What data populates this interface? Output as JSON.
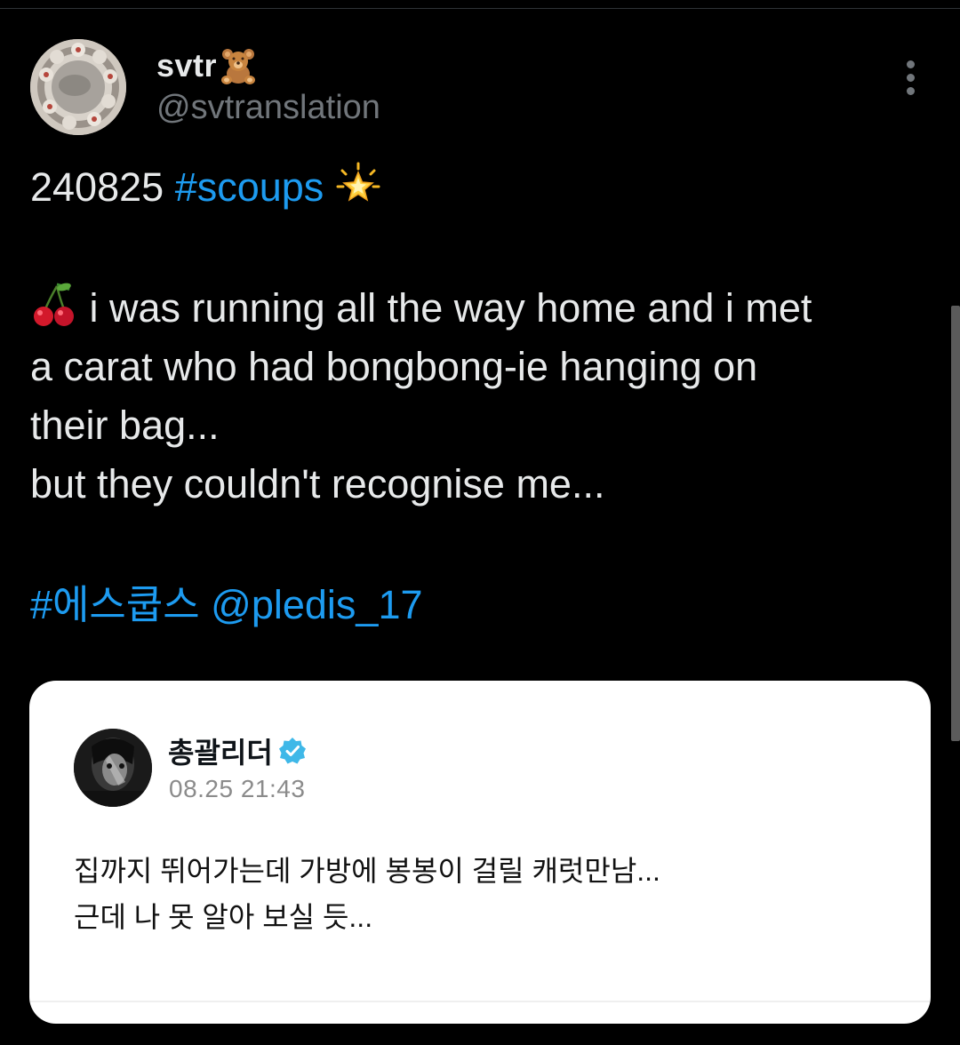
{
  "tweet": {
    "display_name": "svtr",
    "name_emoji": "teddy-bear-emoji",
    "handle": "@svtranslation",
    "body": {
      "date": "240825",
      "hashtag": "#scoups",
      "sparkle_emoji": "glowing-star-emoji",
      "cherry_emoji": "cherries-emoji",
      "line1": " i was running all the way home and i met",
      "line2": "a carat who had bongbong-ie hanging on",
      "line3": "their bag...",
      "line4": "but they couldn't recognise me...",
      "hashtag_korean": "#에스쿱스",
      "mention": "@pledis_17"
    }
  },
  "quoted_post": {
    "author": "총괄리더",
    "verified": true,
    "timestamp": "08.25 21:43",
    "line1": "집까지 뛰어가는데 가방에 봉봉이 걸릴 캐럿만남...",
    "line2": "근데 나 못 알아 보실 듯..."
  },
  "colors": {
    "background": "#000000",
    "text": "#e7e9ea",
    "secondary": "#71767b",
    "link": "#1d9bf0",
    "card": "#ffffff",
    "verified": "#1d9bf0"
  }
}
